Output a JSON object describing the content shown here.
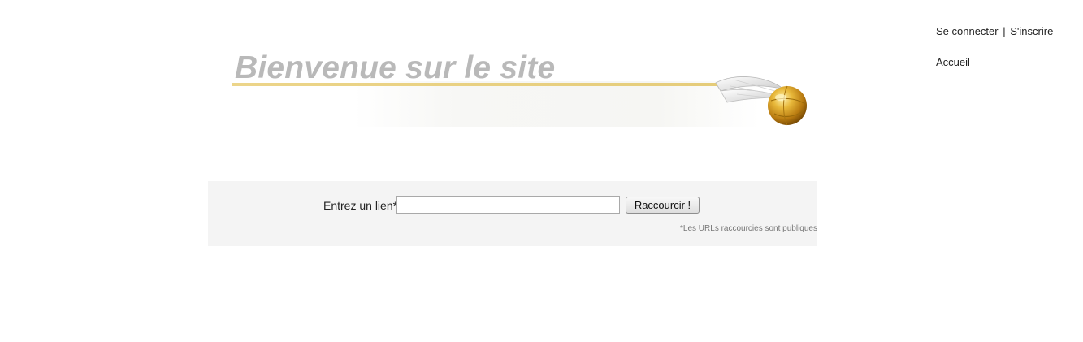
{
  "top_links": {
    "login": "Se connecter",
    "separator": "|",
    "register": "S'inscrire"
  },
  "nav": {
    "home": "Accueil"
  },
  "banner": {
    "title": "Bienvenue sur le site",
    "line_color": "#e8cf80"
  },
  "form": {
    "label": "Entrez un lien*",
    "input_value": "",
    "input_placeholder": "",
    "submit_label": "Raccourcir !",
    "footnote": "*Les URLs raccourcies sont publiques"
  },
  "colors": {
    "panel_background": "#f4f4f4",
    "title_gray": "#b9b9b9",
    "snitch_gold": "#d9a520"
  }
}
